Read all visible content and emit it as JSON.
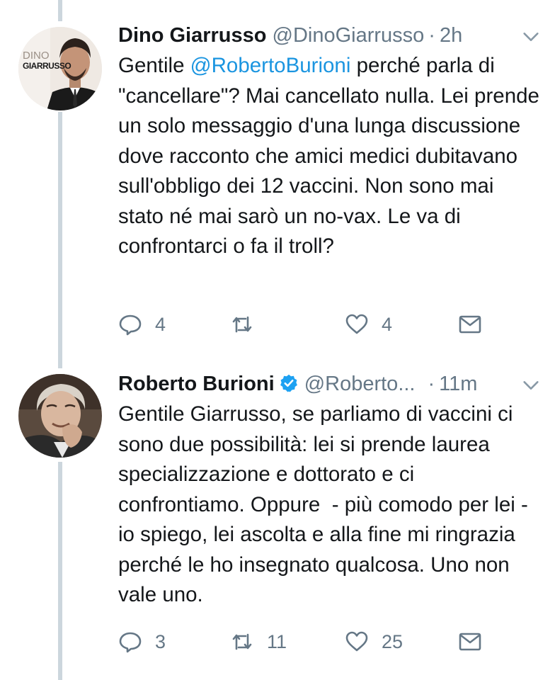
{
  "thread": {
    "tweets": [
      {
        "author_name": "Dino Giarrusso",
        "handle": "@DinoGiarrusso",
        "separator": "·",
        "time": "2h",
        "avatar_text_line1": "DINO",
        "avatar_text_line2": "GIARRUSSO",
        "body_pre": "Gentile ",
        "mention": "@RobertoBurioni",
        "body_post": " perché parla di \"cancellare\"? Mai cancellato nulla. Lei prende un solo messaggio d'una lunga discussione dove racconto che amici medici dubitavano sull'obbligo dei 12 vaccini. Non sono mai stato né mai sarò un no-vax. Le va di confrontarci o fa il troll?",
        "reply_count": "4",
        "retweet_count": "",
        "like_count": "4"
      },
      {
        "author_name": "Roberto Burioni",
        "handle": "@Roberto...",
        "separator": "·",
        "time": "11m",
        "verified": true,
        "body_pre": "Gentile Giarrusso, se parliamo di vaccini ci sono due possibilità: lei si prende laurea specializzazione e dottorato e ci confrontiamo. Oppure  - più comodo per lei - io spiego, lei ascolta e alla fine mi ringrazia perché le ho insegnato qualcosa. Uno non vale uno.",
        "mention": "",
        "body_post": "",
        "reply_count": "3",
        "retweet_count": "11",
        "like_count": "25"
      }
    ]
  },
  "colors": {
    "text": "#14171a",
    "muted": "#657786",
    "link": "#1b95e0",
    "thread_line": "#ccd6dd",
    "verified": "#1da1f2"
  }
}
